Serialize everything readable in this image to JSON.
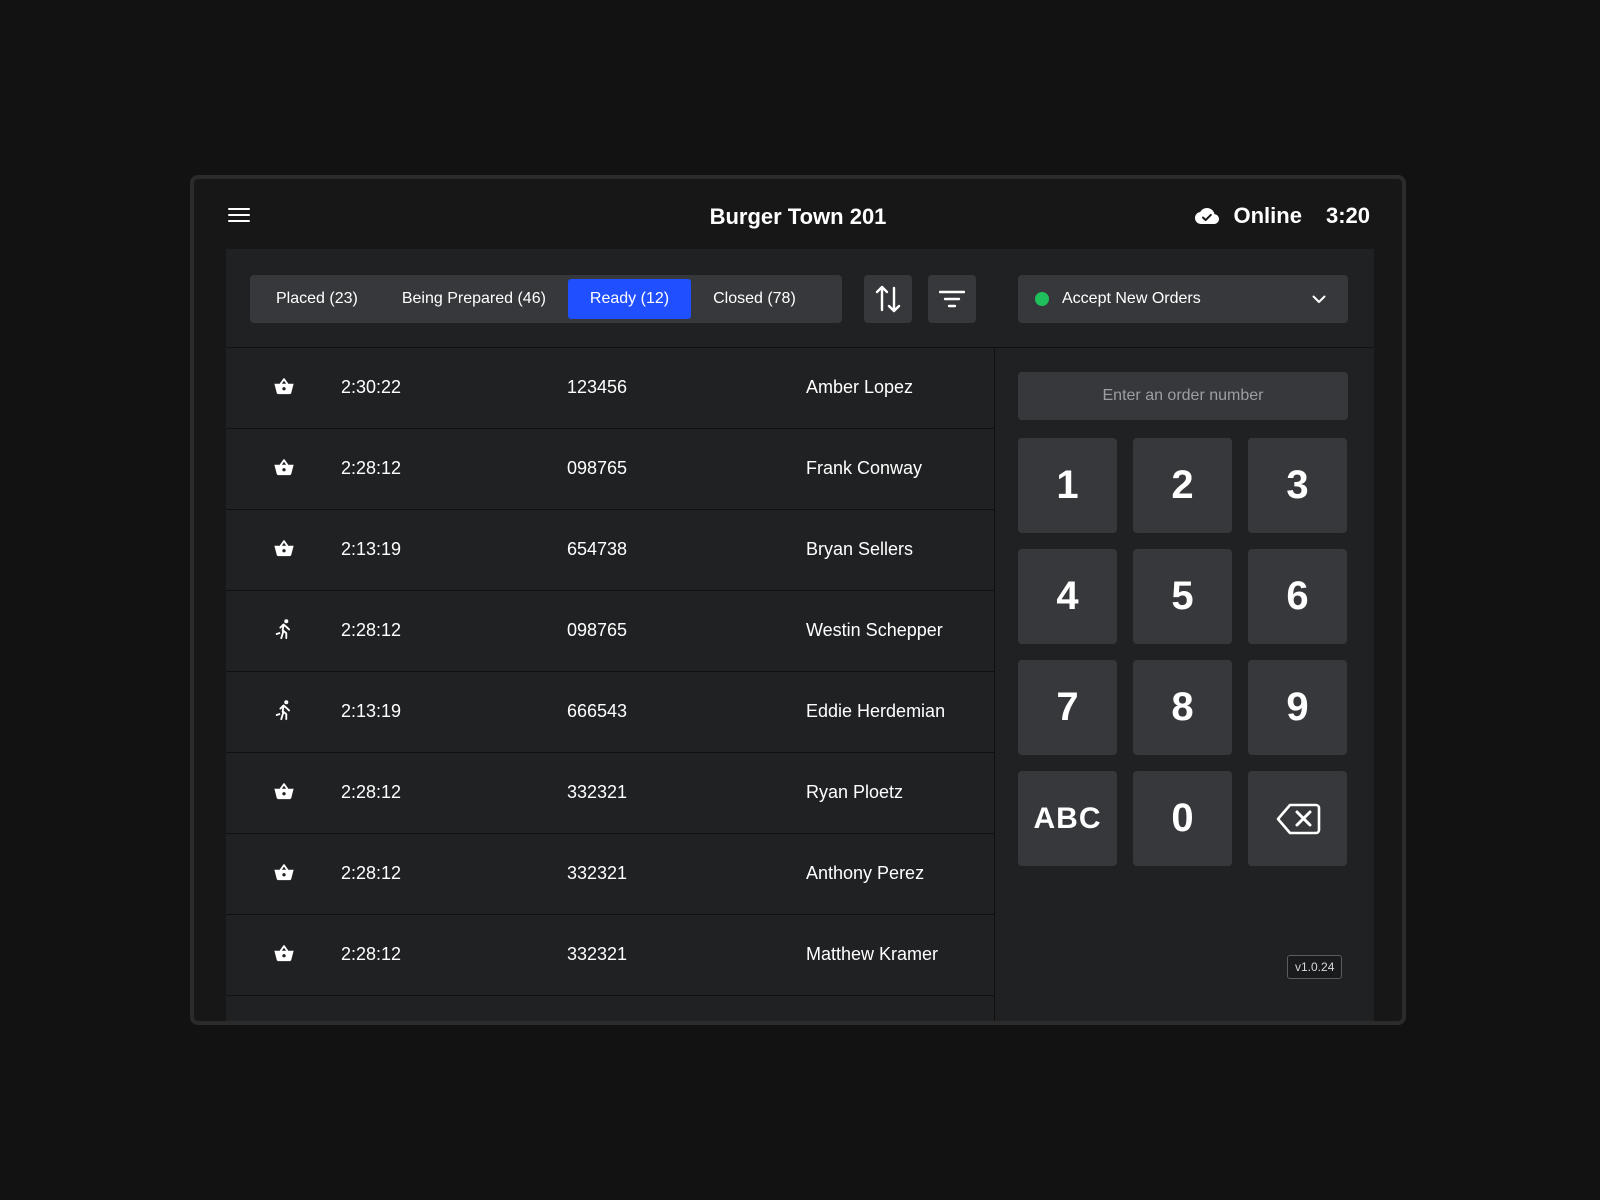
{
  "header": {
    "store_name": "Burger Town 201",
    "connection_status": "Online",
    "clock": "3:20",
    "menu_icon": "hamburger-menu-icon",
    "status_icon": "cloud-check-icon"
  },
  "tabs": [
    {
      "label": "Placed (23)",
      "active": false
    },
    {
      "label": "Being Prepared (46)",
      "active": false
    },
    {
      "label": "Ready (12)",
      "active": true
    },
    {
      "label": "Closed (78)",
      "active": false
    }
  ],
  "toolbar": {
    "sort_icon": "sort-arrows-icon",
    "filter_icon": "filter-lines-icon"
  },
  "accept_orders": {
    "label": "Accept New Orders",
    "status_color": "#1fbf5b",
    "icon": "chevron-down-icon"
  },
  "orders": [
    {
      "icon": "basket-icon",
      "time": "2:30:22",
      "number": "123456",
      "name": "Amber Lopez"
    },
    {
      "icon": "basket-icon",
      "time": "2:28:12",
      "number": "098765",
      "name": "Frank Conway"
    },
    {
      "icon": "basket-icon",
      "time": "2:13:19",
      "number": "654738",
      "name": "Bryan Sellers"
    },
    {
      "icon": "runner-icon",
      "time": "2:28:12",
      "number": "098765",
      "name": "Westin Schepper"
    },
    {
      "icon": "runner-icon",
      "time": "2:13:19",
      "number": "666543",
      "name": "Eddie Herdemian"
    },
    {
      "icon": "basket-icon",
      "time": "2:28:12",
      "number": "332321",
      "name": "Ryan Ploetz"
    },
    {
      "icon": "basket-icon",
      "time": "2:28:12",
      "number": "332321",
      "name": "Anthony Perez"
    },
    {
      "icon": "basket-icon",
      "time": "2:28:12",
      "number": "332321",
      "name": "Matthew Kramer"
    }
  ],
  "order_search": {
    "placeholder": "Enter an order number",
    "value": ""
  },
  "keypad": {
    "keys": [
      "1",
      "2",
      "3",
      "4",
      "5",
      "6",
      "7",
      "8",
      "9",
      "ABC",
      "0"
    ],
    "backspace_icon": "backspace-icon"
  },
  "version": "v1.0.24",
  "colors": {
    "accent": "#1f4fff",
    "online_dot": "#1fbf5b"
  }
}
